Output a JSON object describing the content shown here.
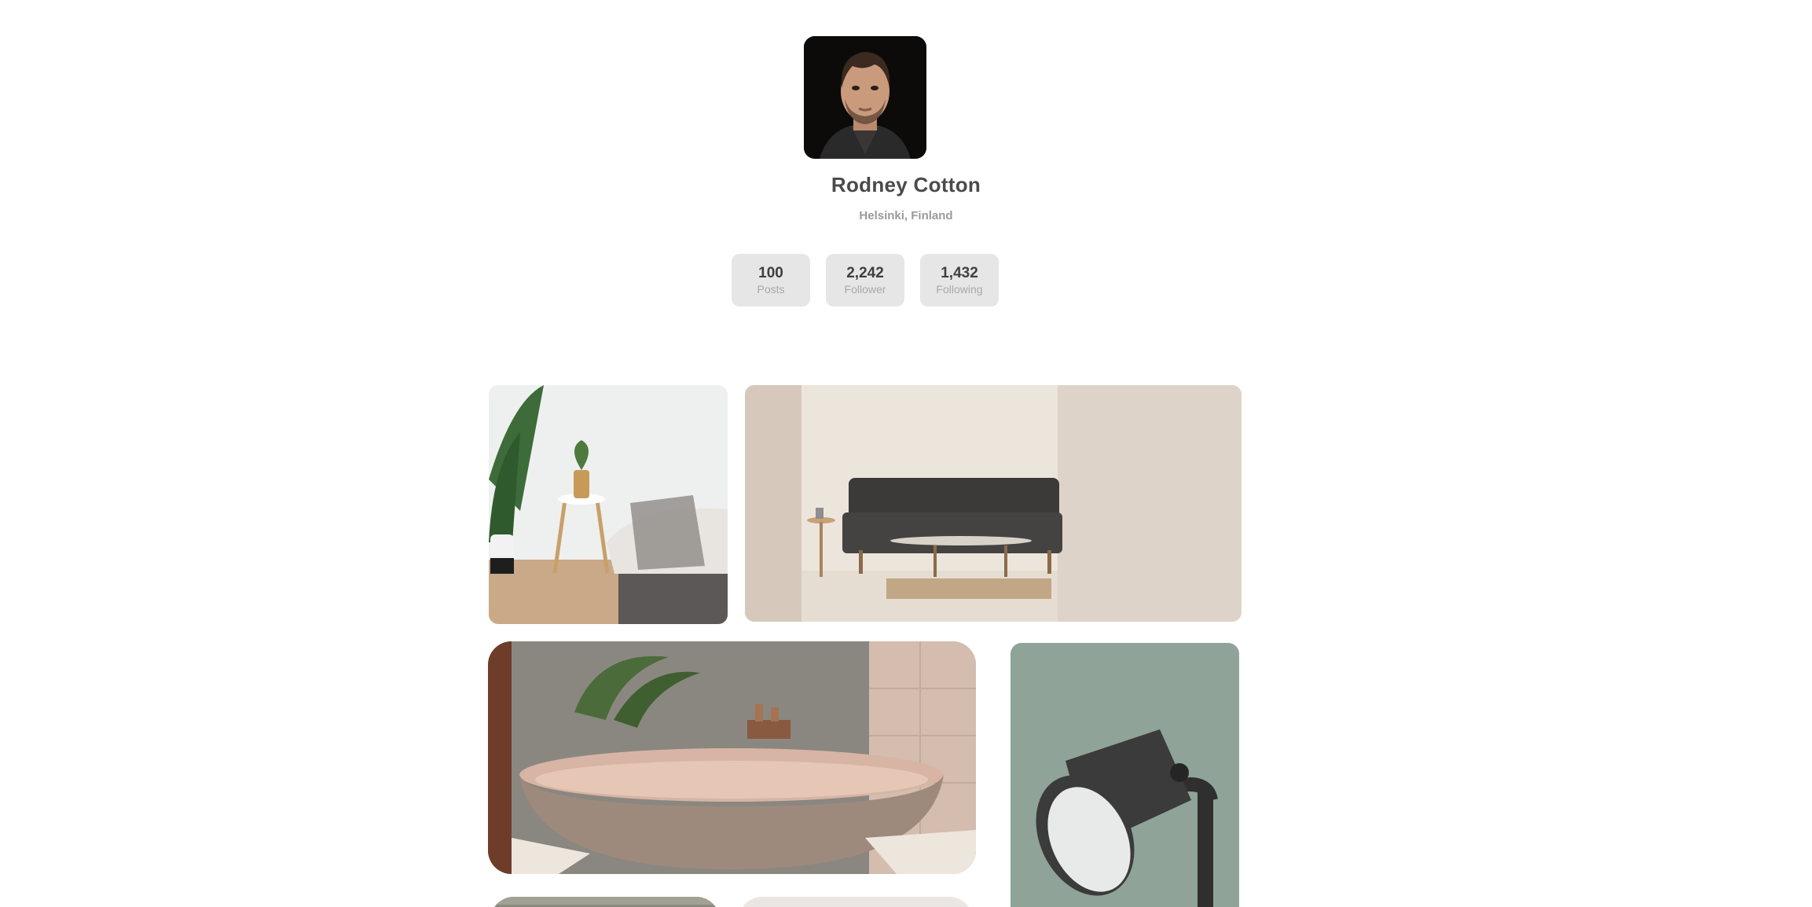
{
  "profile": {
    "name": "Rodney Cotton",
    "location": "Helsinki, Finland",
    "avatar_icon": "portrait-photo"
  },
  "stats": [
    {
      "value": "100",
      "label": "Posts"
    },
    {
      "value": "2,242",
      "label": "Follower"
    },
    {
      "value": "1,432",
      "label": "Following"
    }
  ],
  "gallery": [
    {
      "subject": "bedroom-plant-photo"
    },
    {
      "subject": "living-room-sofa-photo"
    },
    {
      "subject": "bathtub-photo"
    },
    {
      "subject": "desk-lamp-photo"
    },
    {
      "subject": "interior-photo"
    },
    {
      "subject": "interior-photo"
    }
  ],
  "colors": {
    "text": "#4a4a4a",
    "muted": "#9a9a9a",
    "stat_bg": "#e6e6e6",
    "background": "#ffffff"
  }
}
